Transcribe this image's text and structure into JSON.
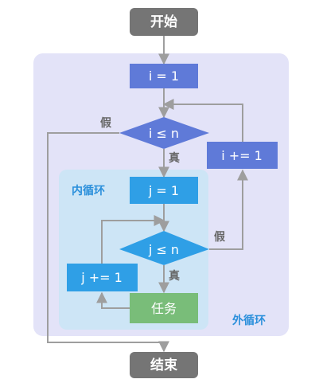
{
  "colors": {
    "terminal_fill": "#757575",
    "outer_region": "#e3e3f8",
    "inner_region": "#cde5f6",
    "outer_node": "#5f7ad8",
    "inner_node": "#2f9fe6",
    "task_node": "#79bd79",
    "arrow": "#9e9e9e",
    "label_blue": "#2a8fdb",
    "label_gray": "#666666",
    "white": "#ffffff"
  },
  "diagram": {
    "start": "开始",
    "end": "结束",
    "outer_loop_label": "外循环",
    "inner_loop_label": "内循环",
    "init_i": "i = 1",
    "cond_i": "i ≤ n",
    "incr_i": "i += 1",
    "init_j": "j = 1",
    "cond_j": "j ≤ n",
    "incr_j": "j += 1",
    "task": "任务",
    "true_label": "真",
    "false_label": "假"
  }
}
